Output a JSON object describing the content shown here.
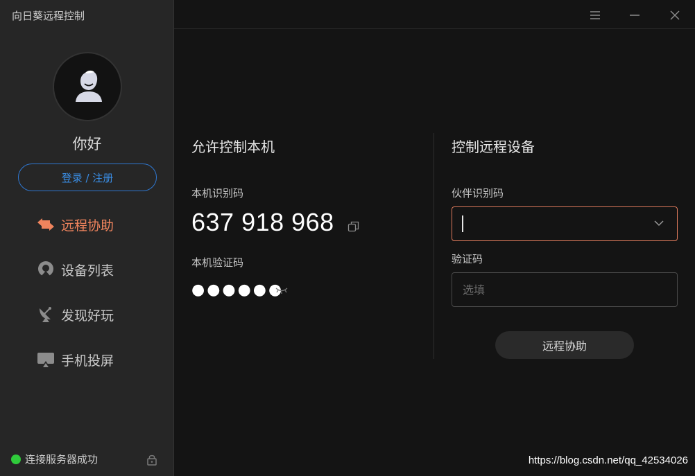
{
  "app": {
    "title": "向日葵远程控制"
  },
  "user": {
    "greeting": "你好",
    "login_label": "登录 / 注册"
  },
  "nav": {
    "items": [
      {
        "label": "远程协助",
        "icon": "swap-arrows-icon",
        "active": true
      },
      {
        "label": "设备列表",
        "icon": "device-list-icon",
        "active": false
      },
      {
        "label": "发现好玩",
        "icon": "satellite-dish-icon",
        "active": false
      },
      {
        "label": "手机投屏",
        "icon": "screen-cast-icon",
        "active": false
      }
    ]
  },
  "status": {
    "text": "连接服务器成功",
    "color": "#2fcb3b"
  },
  "allow": {
    "title": "允许控制本机",
    "id_label": "本机识别码",
    "id_value": "637 918 968",
    "code_label": "本机验证码",
    "code_value": "●●●●●●"
  },
  "control": {
    "title": "控制远程设备",
    "partner_label": "伙伴识别码",
    "partner_value": "",
    "code_label": "验证码",
    "code_placeholder": "选填",
    "connect_label": "远程协助"
  },
  "colors": {
    "accent": "#f0845d",
    "link": "#3a8ee6",
    "input_focus": "#e07b5c"
  },
  "watermark": "https://blog.csdn.net/qq_42534026"
}
